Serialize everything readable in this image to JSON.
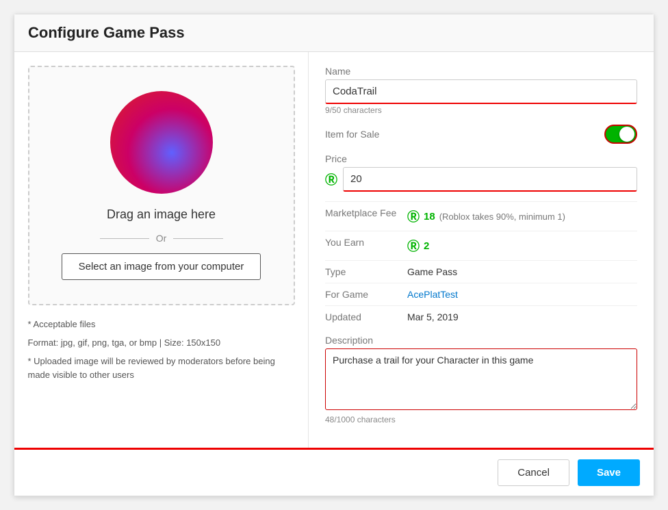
{
  "header": {
    "title": "Configure Game Pass"
  },
  "left": {
    "drag_text": "Drag an image here",
    "or_text": "Or",
    "select_btn": "Select an image from your computer",
    "file_info_line1": "* Acceptable files",
    "file_info_line2": "Format: jpg, gif, png, tga, or bmp | Size: 150x150",
    "file_info_line3": "* Uploaded image will be reviewed by moderators before being made visible to other users"
  },
  "right": {
    "name_label": "Name",
    "name_value": "CodaTrail",
    "name_char_count": "9/50 characters",
    "item_for_sale_label": "Item for Sale",
    "price_label": "Price",
    "price_value": "20",
    "marketplace_fee_label": "Marketplace Fee",
    "marketplace_fee_value": "18",
    "marketplace_fee_note": "(Roblox takes 90%, minimum 1)",
    "you_earn_label": "You Earn",
    "you_earn_value": "2",
    "type_label": "Type",
    "type_value": "Game Pass",
    "for_game_label": "For Game",
    "for_game_value": "AcePlatTest",
    "updated_label": "Updated",
    "updated_value": "Mar 5, 2019",
    "description_label": "Description",
    "description_value": "Purchase a trail for your Character in this game",
    "description_char_count": "48/1000 characters"
  },
  "footer": {
    "cancel_label": "Cancel",
    "save_label": "Save"
  },
  "icons": {
    "robux": "ⓡ"
  }
}
